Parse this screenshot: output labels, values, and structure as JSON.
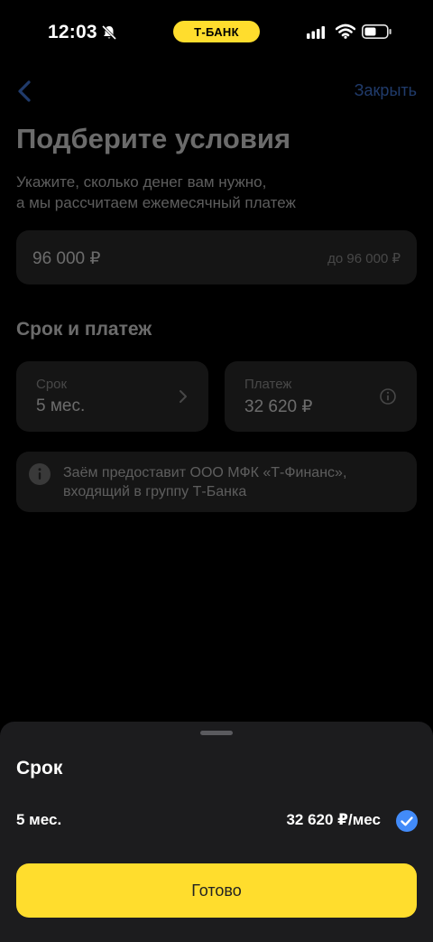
{
  "status_bar": {
    "time": "12:03",
    "brand": "Т-БАНК",
    "icons": [
      "bell-off-icon",
      "signal-icon",
      "wifi-icon",
      "battery-icon"
    ]
  },
  "header": {
    "back_icon": "chevron-left-icon",
    "close_label": "Закрыть"
  },
  "page": {
    "title": "Подберите условия",
    "subtitle": "Укажите, сколько денег вам нужно,\nа мы рассчитаем ежемесячный платеж",
    "amount": {
      "value": "96 000 ₽",
      "limit": "до 96 000 ₽"
    },
    "section_title": "Срок и платеж",
    "term_card": {
      "label": "Срок",
      "value": "5 мес."
    },
    "payment_card": {
      "label": "Платеж",
      "value": "32 620 ₽"
    },
    "notice": "Заём предоставит ООО МФК «Т-Финанс»,\nвходящий в группу Т-Банка"
  },
  "sheet": {
    "title": "Срок",
    "option": {
      "term": "5 мес.",
      "payment": "32 620 ₽/мес",
      "selected": true
    },
    "done_label": "Готово"
  },
  "colors": {
    "accent_yellow": "#ffdd2d",
    "link_blue": "#4d8cff",
    "check_blue": "#428bf9",
    "sheet_bg": "#1c1c1e"
  }
}
